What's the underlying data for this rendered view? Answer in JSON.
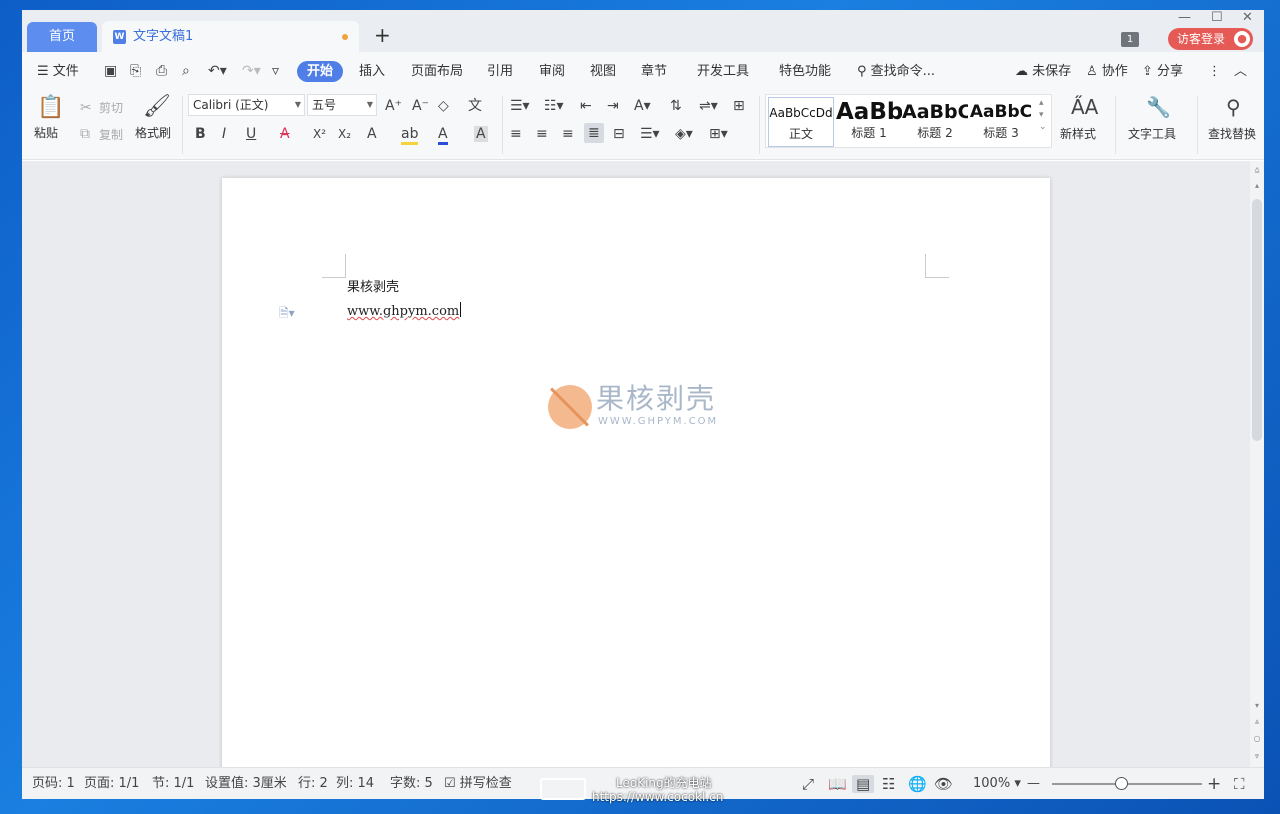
{
  "tabs": {
    "home": "首页",
    "doc_icon": "W",
    "doc": "文字文稿1",
    "new_tab": "+"
  },
  "window_controls": {
    "minimize": "—",
    "maximize": "☐",
    "close": "✕"
  },
  "title_right": {
    "badge": "1",
    "login": "访客登录",
    "avatar": "●"
  },
  "menu": {
    "file": "☰ 文件",
    "items": [
      "开始",
      "插入",
      "页面布局",
      "引用",
      "审阅",
      "视图",
      "章节",
      "开发工具",
      "特色功能"
    ],
    "search": "查找命令...",
    "unsaved": "未保存",
    "collab": "协作",
    "share": "分享"
  },
  "clipboard": {
    "paste": "粘贴",
    "cut": "剪切",
    "copy": "复制",
    "format_painter": "格式刷"
  },
  "font": {
    "name": "Calibri (正文)",
    "size": "五号",
    "bold": "B",
    "italic": "I",
    "underline": "U",
    "strikethrough": "A",
    "superscript": "X²",
    "subscript": "X₂",
    "text_effects": "A",
    "highlight": "ab",
    "font_color": "A",
    "char_shading": "A",
    "grow": "A⁺",
    "shrink": "A⁻",
    "clear": "◇",
    "phonetic": "文"
  },
  "styles": [
    {
      "preview": "AaBbCcDd",
      "label": "正文"
    },
    {
      "preview": "AaBb",
      "label": "标题 1"
    },
    {
      "preview": "AaBbC",
      "label": "标题 2"
    },
    {
      "preview": "AaBbC",
      "label": "标题 3"
    }
  ],
  "ribbon_right": {
    "new_style": "新样式",
    "text_tools": "文字工具",
    "find_replace": "查找替换"
  },
  "document": {
    "line1": "果核剥壳",
    "line2": "www.ghpym.com"
  },
  "watermark": {
    "title": "果核剥壳",
    "url": "WWW.GHPYM.COM"
  },
  "status": {
    "page_num": "页码: 1",
    "pages": "页面: 1/1",
    "section": "节: 1/1",
    "setting": "设置值: 3厘米",
    "row": "行: 2",
    "col": "列: 14",
    "words": "字数: 5",
    "spell": "拼写检查",
    "zoom": "100%",
    "zoom_minus": "—",
    "zoom_plus": "+"
  },
  "overlay": {
    "line1": "LeoKing的充电站",
    "line2": "https://www.cocokl.cn"
  }
}
